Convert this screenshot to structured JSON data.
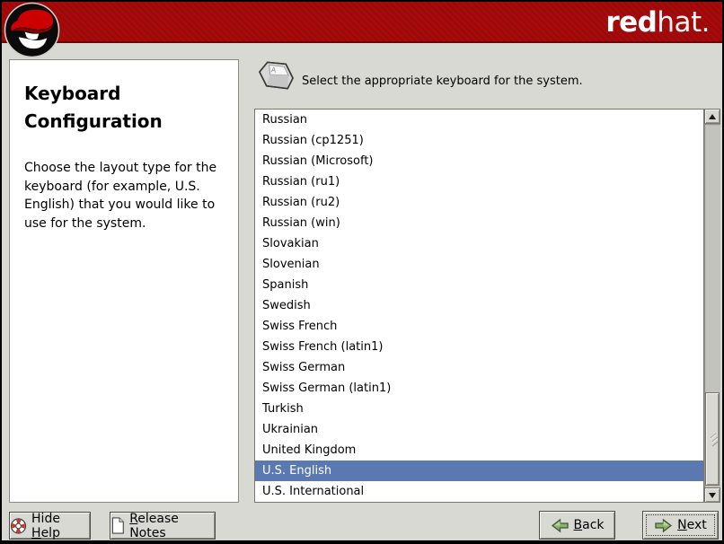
{
  "header": {
    "brand_bold": "red",
    "brand_light": "hat.",
    "logo": "redhat-shadowman-logo"
  },
  "sidebar": {
    "title": "Keyboard Configuration",
    "body": "Choose the layout type for the keyboard (for example, U.S. English) that you would like to use for the system."
  },
  "main": {
    "prompt": "Select the appropriate keyboard for the system.",
    "items": [
      "Russian",
      "Russian (cp1251)",
      "Russian (Microsoft)",
      "Russian (ru1)",
      "Russian (ru2)",
      "Russian (win)",
      "Slovakian",
      "Slovenian",
      "Spanish",
      "Swedish",
      "Swiss French",
      "Swiss French (latin1)",
      "Swiss German",
      "Swiss German (latin1)",
      "Turkish",
      "Ukrainian",
      "United Kingdom",
      "U.S. English",
      "U.S. International"
    ],
    "selected": "U.S. English"
  },
  "buttons": {
    "hide_help": {
      "pre": "Hide ",
      "u": "H",
      "post": "elp"
    },
    "release_notes": {
      "pre": "",
      "u": "R",
      "post": "elease Notes"
    },
    "back": {
      "pre": "",
      "u": "B",
      "post": "ack"
    },
    "next": {
      "pre": "",
      "u": "N",
      "post": "ext"
    }
  },
  "colors": {
    "header_red": "#a60a0a",
    "selection_blue": "#5a79b0",
    "window_gray": "#d9d9d3",
    "arrow_green": "#8fae71"
  }
}
